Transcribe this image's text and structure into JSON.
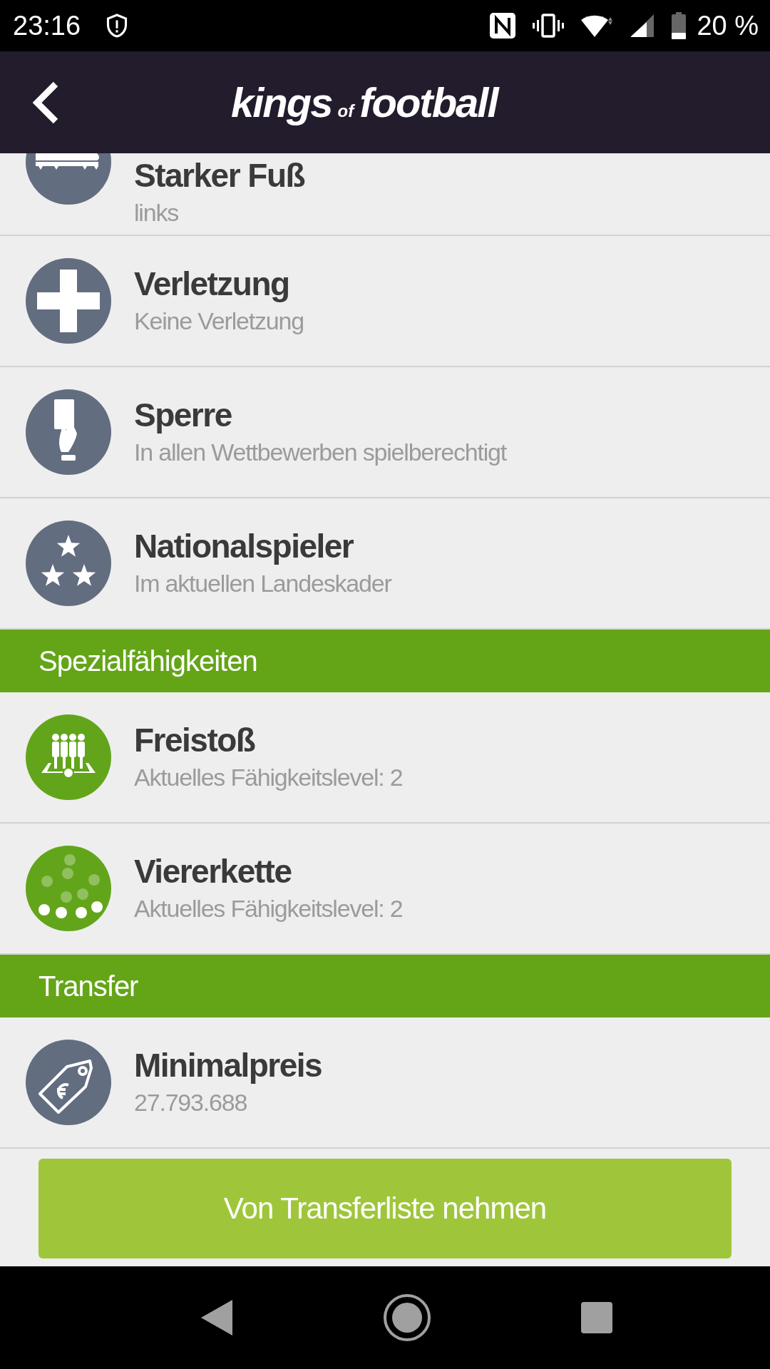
{
  "status_bar": {
    "time": "23:16",
    "battery": "20 %"
  },
  "header": {
    "logo": {
      "first": "kings",
      "middle": "of",
      "last": "football"
    }
  },
  "sections": [
    {
      "rows": [
        {
          "kind": "boot",
          "color": "#636d80",
          "title": "Starker Fuß",
          "value": "links"
        },
        {
          "kind": "cross",
          "color": "#636d80",
          "title": "Verletzung",
          "value": "Keine Verletzung"
        },
        {
          "kind": "card",
          "color": "#636d80",
          "title": "Sperre",
          "value": "In allen Wettbewerben spielberechtigt"
        },
        {
          "kind": "stars",
          "color": "#636d80",
          "title": "Nationalspieler",
          "value": "Im aktuellen Landeskader"
        }
      ]
    },
    {
      "title": "Spezialfähigkeiten",
      "rows": [
        {
          "kind": "freekick",
          "color": "#62a51a",
          "title": "Freistoß",
          "value": "Aktuelles Fähigkeitslevel: 2"
        },
        {
          "kind": "formation",
          "color": "#62a51a",
          "title": "Viererkette",
          "value": "Aktuelles Fähigkeitslevel: 2"
        }
      ]
    },
    {
      "title": "Transfer",
      "rows": [
        {
          "kind": "pricetag",
          "color": "#636d80",
          "title": "Minimalpreis",
          "value": "27.793.688"
        }
      ]
    }
  ],
  "action_button": "Von Transferliste nehmen"
}
